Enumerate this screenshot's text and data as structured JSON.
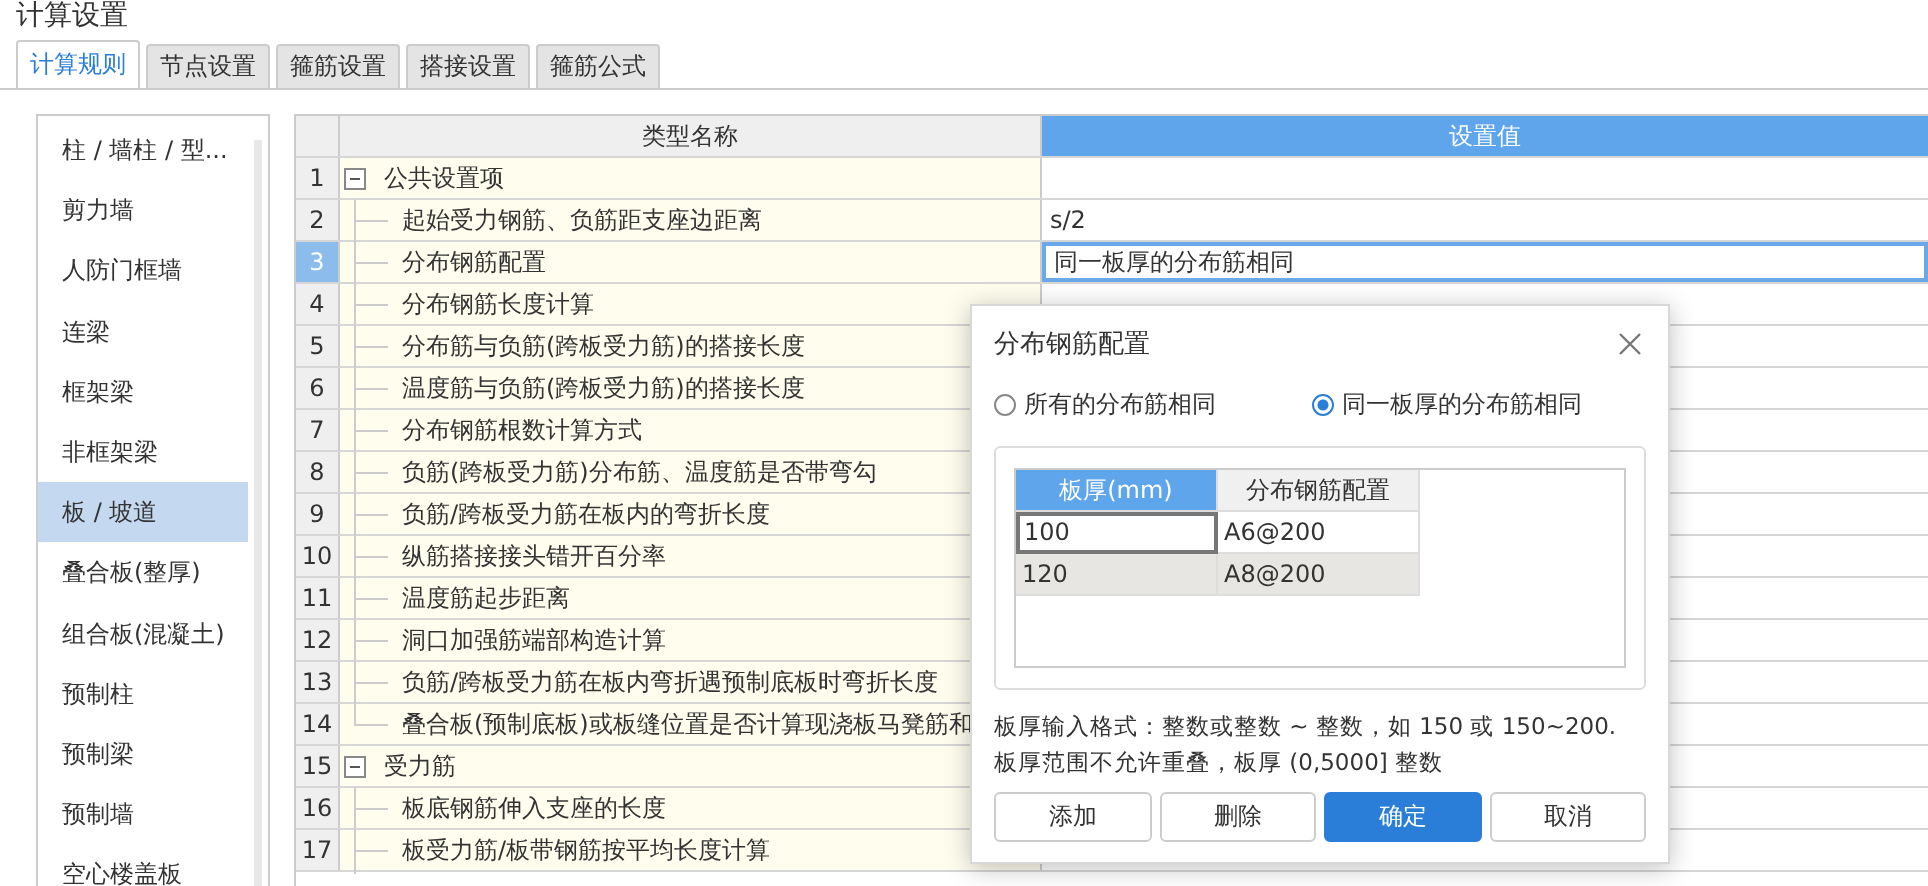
{
  "window": {
    "title": "计算设置"
  },
  "tabs": [
    {
      "label": "计算规则",
      "selected": true
    },
    {
      "label": "节点设置",
      "selected": false
    },
    {
      "label": "箍筋设置",
      "selected": false
    },
    {
      "label": "搭接设置",
      "selected": false
    },
    {
      "label": "箍筋公式",
      "selected": false
    }
  ],
  "sidebar": {
    "items": [
      {
        "label": "柱 / 墙柱 / 型...",
        "selected": false
      },
      {
        "label": "剪力墙",
        "selected": false
      },
      {
        "label": "人防门框墙",
        "selected": false
      },
      {
        "label": "连梁",
        "selected": false
      },
      {
        "label": "框架梁",
        "selected": false
      },
      {
        "label": "非框架梁",
        "selected": false
      },
      {
        "label": "板 / 坡道",
        "selected": true
      },
      {
        "label": "叠合板(整厚)",
        "selected": false
      },
      {
        "label": "组合板(混凝土)",
        "selected": false
      },
      {
        "label": "预制柱",
        "selected": false
      },
      {
        "label": "预制梁",
        "selected": false
      },
      {
        "label": "预制墙",
        "selected": false
      },
      {
        "label": "空心楼盖板",
        "selected": false
      }
    ]
  },
  "table": {
    "columns": [
      "类型名称",
      "设置值"
    ],
    "rows": [
      {
        "num": "1",
        "kind": "group",
        "label": "公共设置项",
        "expanded": true,
        "selected": false
      },
      {
        "num": "2",
        "kind": "item",
        "label": "起始受力钢筋、负筋距支座边距离",
        "value": "s/2",
        "selected": false
      },
      {
        "num": "3",
        "kind": "item",
        "label": "分布钢筋配置",
        "value": "同一板厚的分布筋相同",
        "selected": true
      },
      {
        "num": "4",
        "kind": "item",
        "label": "分布钢筋长度计算",
        "selected": false
      },
      {
        "num": "5",
        "kind": "item",
        "label": "分布筋与负筋(跨板受力筋)的搭接长度",
        "selected": false
      },
      {
        "num": "6",
        "kind": "item",
        "label": "温度筋与负筋(跨板受力筋)的搭接长度",
        "selected": false
      },
      {
        "num": "7",
        "kind": "item",
        "label": "分布钢筋根数计算方式",
        "selected": false
      },
      {
        "num": "8",
        "kind": "item",
        "label": "负筋(跨板受力筋)分布筋、温度筋是否带弯勾",
        "selected": false
      },
      {
        "num": "9",
        "kind": "item",
        "label": "负筋/跨板受力筋在板内的弯折长度",
        "selected": false
      },
      {
        "num": "10",
        "kind": "item",
        "label": "纵筋搭接接头错开百分率",
        "selected": false
      },
      {
        "num": "11",
        "kind": "item",
        "label": "温度筋起步距离",
        "selected": false
      },
      {
        "num": "12",
        "kind": "item",
        "label": "洞口加强筋端部构造计算",
        "selected": false
      },
      {
        "num": "13",
        "kind": "item",
        "label": "负筋/跨板受力筋在板内弯折遇预制底板时弯折长度",
        "selected": false
      },
      {
        "num": "14",
        "kind": "item",
        "label": "叠合板(预制底板)或板缝位置是否计算现浇板马凳筋和",
        "selected": false
      },
      {
        "num": "15",
        "kind": "group",
        "label": "受力筋",
        "expanded": true,
        "selected": false
      },
      {
        "num": "16",
        "kind": "item",
        "label": "板底钢筋伸入支座的长度",
        "selected": false
      },
      {
        "num": "17",
        "kind": "item",
        "label": "板受力筋/板带钢筋按平均长度计算",
        "selected": false
      }
    ]
  },
  "dialog": {
    "title": "分布钢筋配置",
    "radios": [
      {
        "label": "所有的分布筋相同",
        "selected": false
      },
      {
        "label": "同一板厚的分布筋相同",
        "selected": true
      }
    ],
    "columns": [
      "板厚(mm)",
      "分布钢筋配置"
    ],
    "rows": [
      {
        "thickness": "100",
        "config": "A6@200",
        "selected": true
      },
      {
        "thickness": "120",
        "config": "A8@200",
        "selected": false
      }
    ],
    "hint": [
      "板厚输入格式：整数或整数 ~ 整数，如 150 或 150~200.",
      "板厚范围不允许重叠，板厚 (0,5000] 整数"
    ],
    "buttons": [
      {
        "label": "添加",
        "primary": false
      },
      {
        "label": "删除",
        "primary": false
      },
      {
        "label": "确定",
        "primary": true
      },
      {
        "label": "取消",
        "primary": false
      }
    ]
  }
}
